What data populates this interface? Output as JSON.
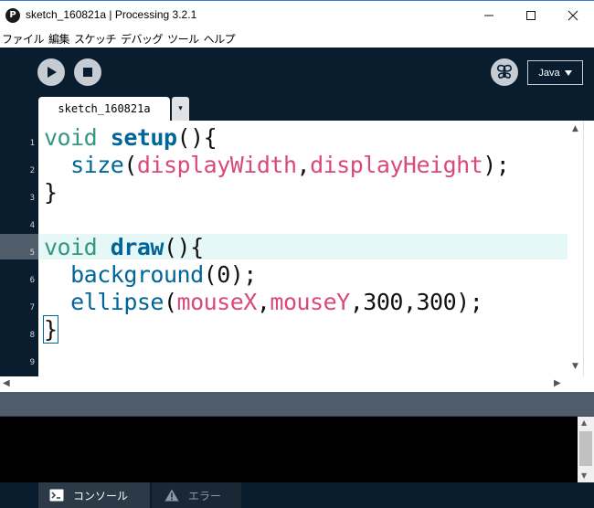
{
  "window": {
    "icon_glyph": "P",
    "title": "sketch_160821a | Processing 3.2.1",
    "controls": [
      "minimize-icon",
      "maximize-icon",
      "close-icon"
    ]
  },
  "menu": {
    "items": [
      "ファイル",
      "編集",
      "スケッチ",
      "デバッグ",
      "ツール",
      "ヘルプ"
    ]
  },
  "toolbar": {
    "run_icon": "play-icon",
    "stop_icon": "stop-icon",
    "debug_icon": "butterfly-icon",
    "mode": "Java"
  },
  "tabs": {
    "active": "sketch_160821a",
    "menu_glyph": "▾"
  },
  "editor": {
    "line_numbers": [
      "1",
      "2",
      "3",
      "4",
      "5",
      "6",
      "7",
      "8",
      "9"
    ],
    "current_line": "5",
    "code": [
      "void setup(){",
      "  size(displayWidth,displayHeight);",
      "}",
      "",
      "void draw(){",
      "  background(0);",
      "  ellipse(mouseX,mouseY,300,300);",
      "}",
      ""
    ],
    "tokens": {
      "void": "void",
      "setup": "setup",
      "draw": "draw",
      "size": "size",
      "displayWidth": "displayWidth",
      "displayHeight": "displayHeight",
      "background": "background",
      "ellipse": "ellipse",
      "mouseX": "mouseX",
      "mouseY": "mouseY",
      "zero": "0",
      "n300": "300"
    },
    "colors": {
      "keyword": "#33997e",
      "function": "#006699",
      "constant": "#d94a7a",
      "current_line": "#e6f7f8"
    }
  },
  "console_tabs": {
    "console": "コンソール",
    "errors": "エラー"
  },
  "theme": {
    "chrome_dark": "#0a1d2f",
    "message_bar": "#4f5d6a"
  }
}
